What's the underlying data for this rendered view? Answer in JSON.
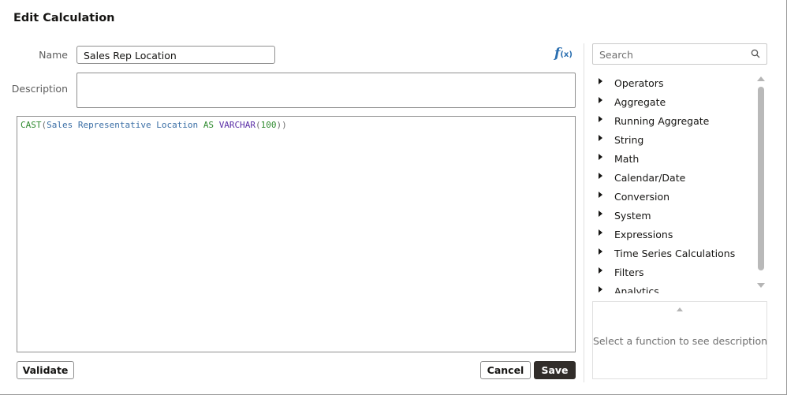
{
  "dialog": {
    "title": "Edit Calculation"
  },
  "form": {
    "name_label": "Name",
    "name_value": "Sales Rep Location",
    "description_label": "Description",
    "description_value": ""
  },
  "function_icon": "function-fx-icon",
  "editor": {
    "tokens": {
      "cast": "CAST",
      "open_paren": "(",
      "column": "Sales Representative Location",
      "as": "AS",
      "type": "VARCHAR",
      "type_open": "(",
      "length": "100",
      "close": "))"
    }
  },
  "buttons": {
    "validate": "Validate",
    "cancel": "Cancel",
    "save": "Save"
  },
  "function_panel": {
    "search_placeholder": "Search",
    "categories": [
      "Operators",
      "Aggregate",
      "Running Aggregate",
      "String",
      "Math",
      "Calendar/Date",
      "Conversion",
      "System",
      "Expressions",
      "Time Series Calculations",
      "Filters",
      "Analytics"
    ],
    "description_message": "Select a function to see description"
  },
  "colors": {
    "primary_button": "#312d2a",
    "fx_accent": "#2b6fb0"
  }
}
